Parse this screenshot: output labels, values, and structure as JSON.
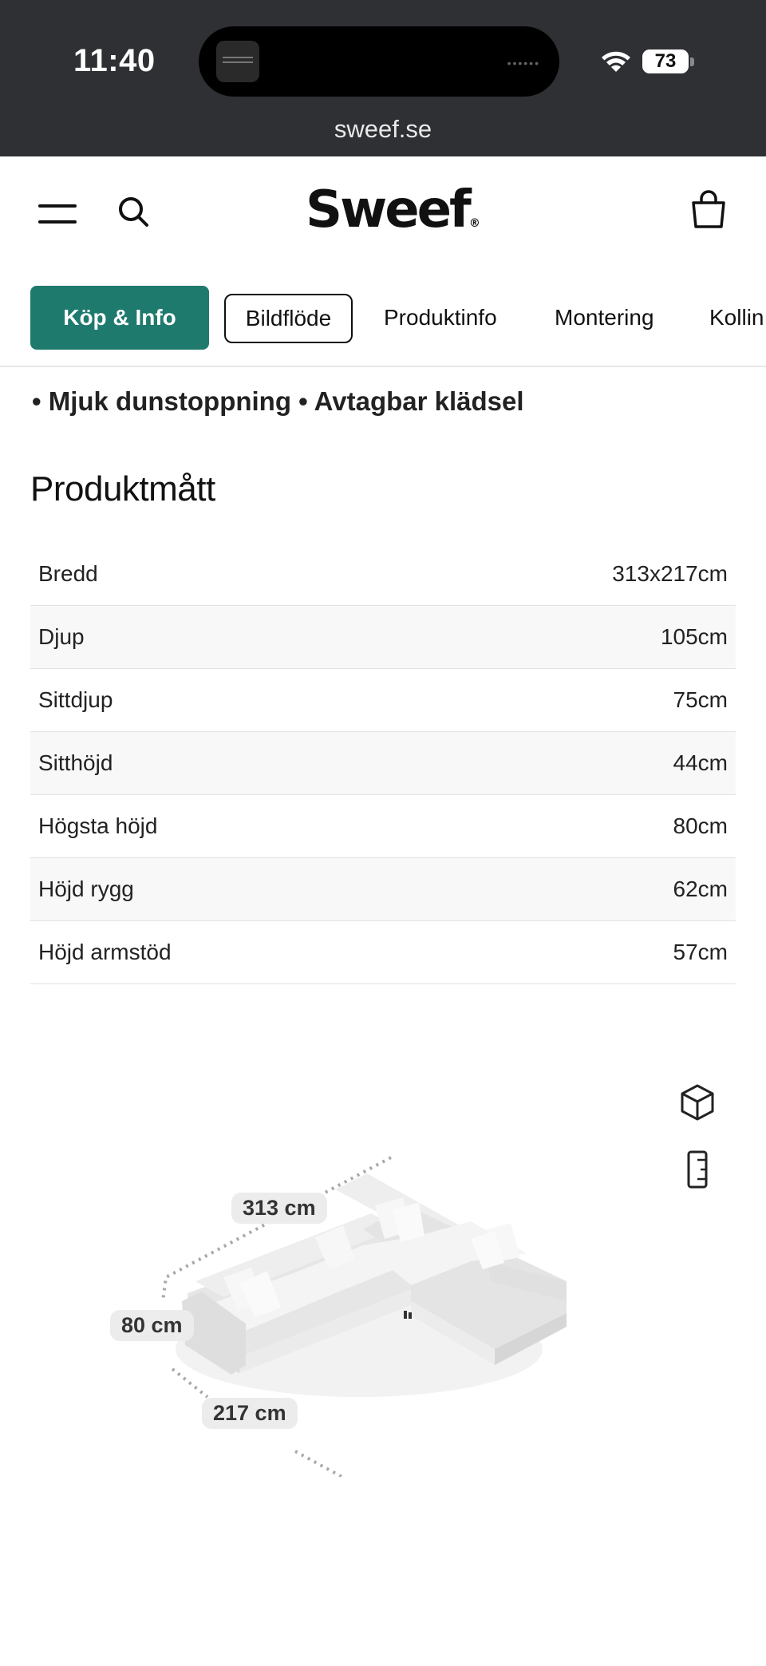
{
  "status_bar": {
    "time": "11:40",
    "battery": "73"
  },
  "browser": {
    "url": "sweef.se"
  },
  "header": {
    "logo": "Sweef",
    "logo_mark": "®"
  },
  "tabs": [
    {
      "label": "Köp & Info"
    },
    {
      "label": "Bildflöde"
    },
    {
      "label": "Produktinfo"
    },
    {
      "label": "Montering"
    },
    {
      "label": "Kollin"
    }
  ],
  "features_text": "• Mjuk dunstoppning • Avtagbar klädsel",
  "dimensions": {
    "title": "Produktmått",
    "rows": [
      {
        "label": "Bredd",
        "value": "313x217cm"
      },
      {
        "label": "Djup",
        "value": "105cm"
      },
      {
        "label": "Sittdjup",
        "value": "75cm"
      },
      {
        "label": "Sitthöjd",
        "value": "44cm"
      },
      {
        "label": "Högsta höjd",
        "value": "80cm"
      },
      {
        "label": "Höjd rygg",
        "value": "62cm"
      },
      {
        "label": "Höjd armstöd",
        "value": "57cm"
      }
    ]
  },
  "viewer": {
    "labels": {
      "width": "313 cm",
      "height": "80 cm",
      "depth": "217 cm"
    },
    "icons": [
      "cube-icon",
      "ruler-icon"
    ]
  },
  "colors": {
    "accent": "#1f7a6e",
    "chrome": "#2f3034"
  }
}
